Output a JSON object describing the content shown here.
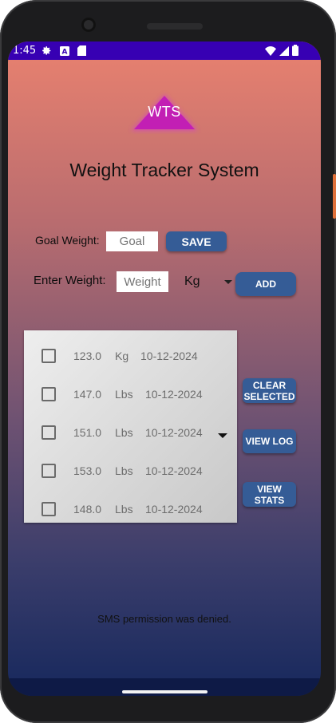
{
  "status_bar": {
    "time": "1:45",
    "left_icons": [
      "gear-icon",
      "text-a-icon",
      "sd-card-icon"
    ],
    "right_icons": [
      "wifi-icon",
      "signal-icon",
      "battery-icon"
    ]
  },
  "logo": {
    "text": "WTS",
    "color": "#c21fb4"
  },
  "title": "Weight Tracker System",
  "goal": {
    "label": "Goal Weight:",
    "input_placeholder": "Goal",
    "save_label": "SAVE"
  },
  "entry": {
    "label": "Enter Weight:",
    "input_placeholder": "Weight",
    "unit_selected": "Kg",
    "add_label": "ADD"
  },
  "log": {
    "rows": [
      {
        "weight": "123.0",
        "unit": "Kg",
        "date": "10-12-2024"
      },
      {
        "weight": "147.0",
        "unit": "Lbs",
        "date": "10-12-2024"
      },
      {
        "weight": "151.0",
        "unit": "Lbs",
        "date": "10-12-2024"
      },
      {
        "weight": "153.0",
        "unit": "Lbs",
        "date": "10-12-2024"
      },
      {
        "weight": "148.0",
        "unit": "Lbs",
        "date": "10-12-2024"
      }
    ]
  },
  "actions": {
    "clear_selected": "CLEAR SELECTED",
    "view_log": "VIEW LOG",
    "view_stats": "VIEW STATS"
  },
  "message": "SMS permission was denied.",
  "colors": {
    "accent_button": "#355c96",
    "status_bar": "#3700b3",
    "gradient_top": "#e47f6f",
    "gradient_bottom": "#1a2a5e"
  }
}
